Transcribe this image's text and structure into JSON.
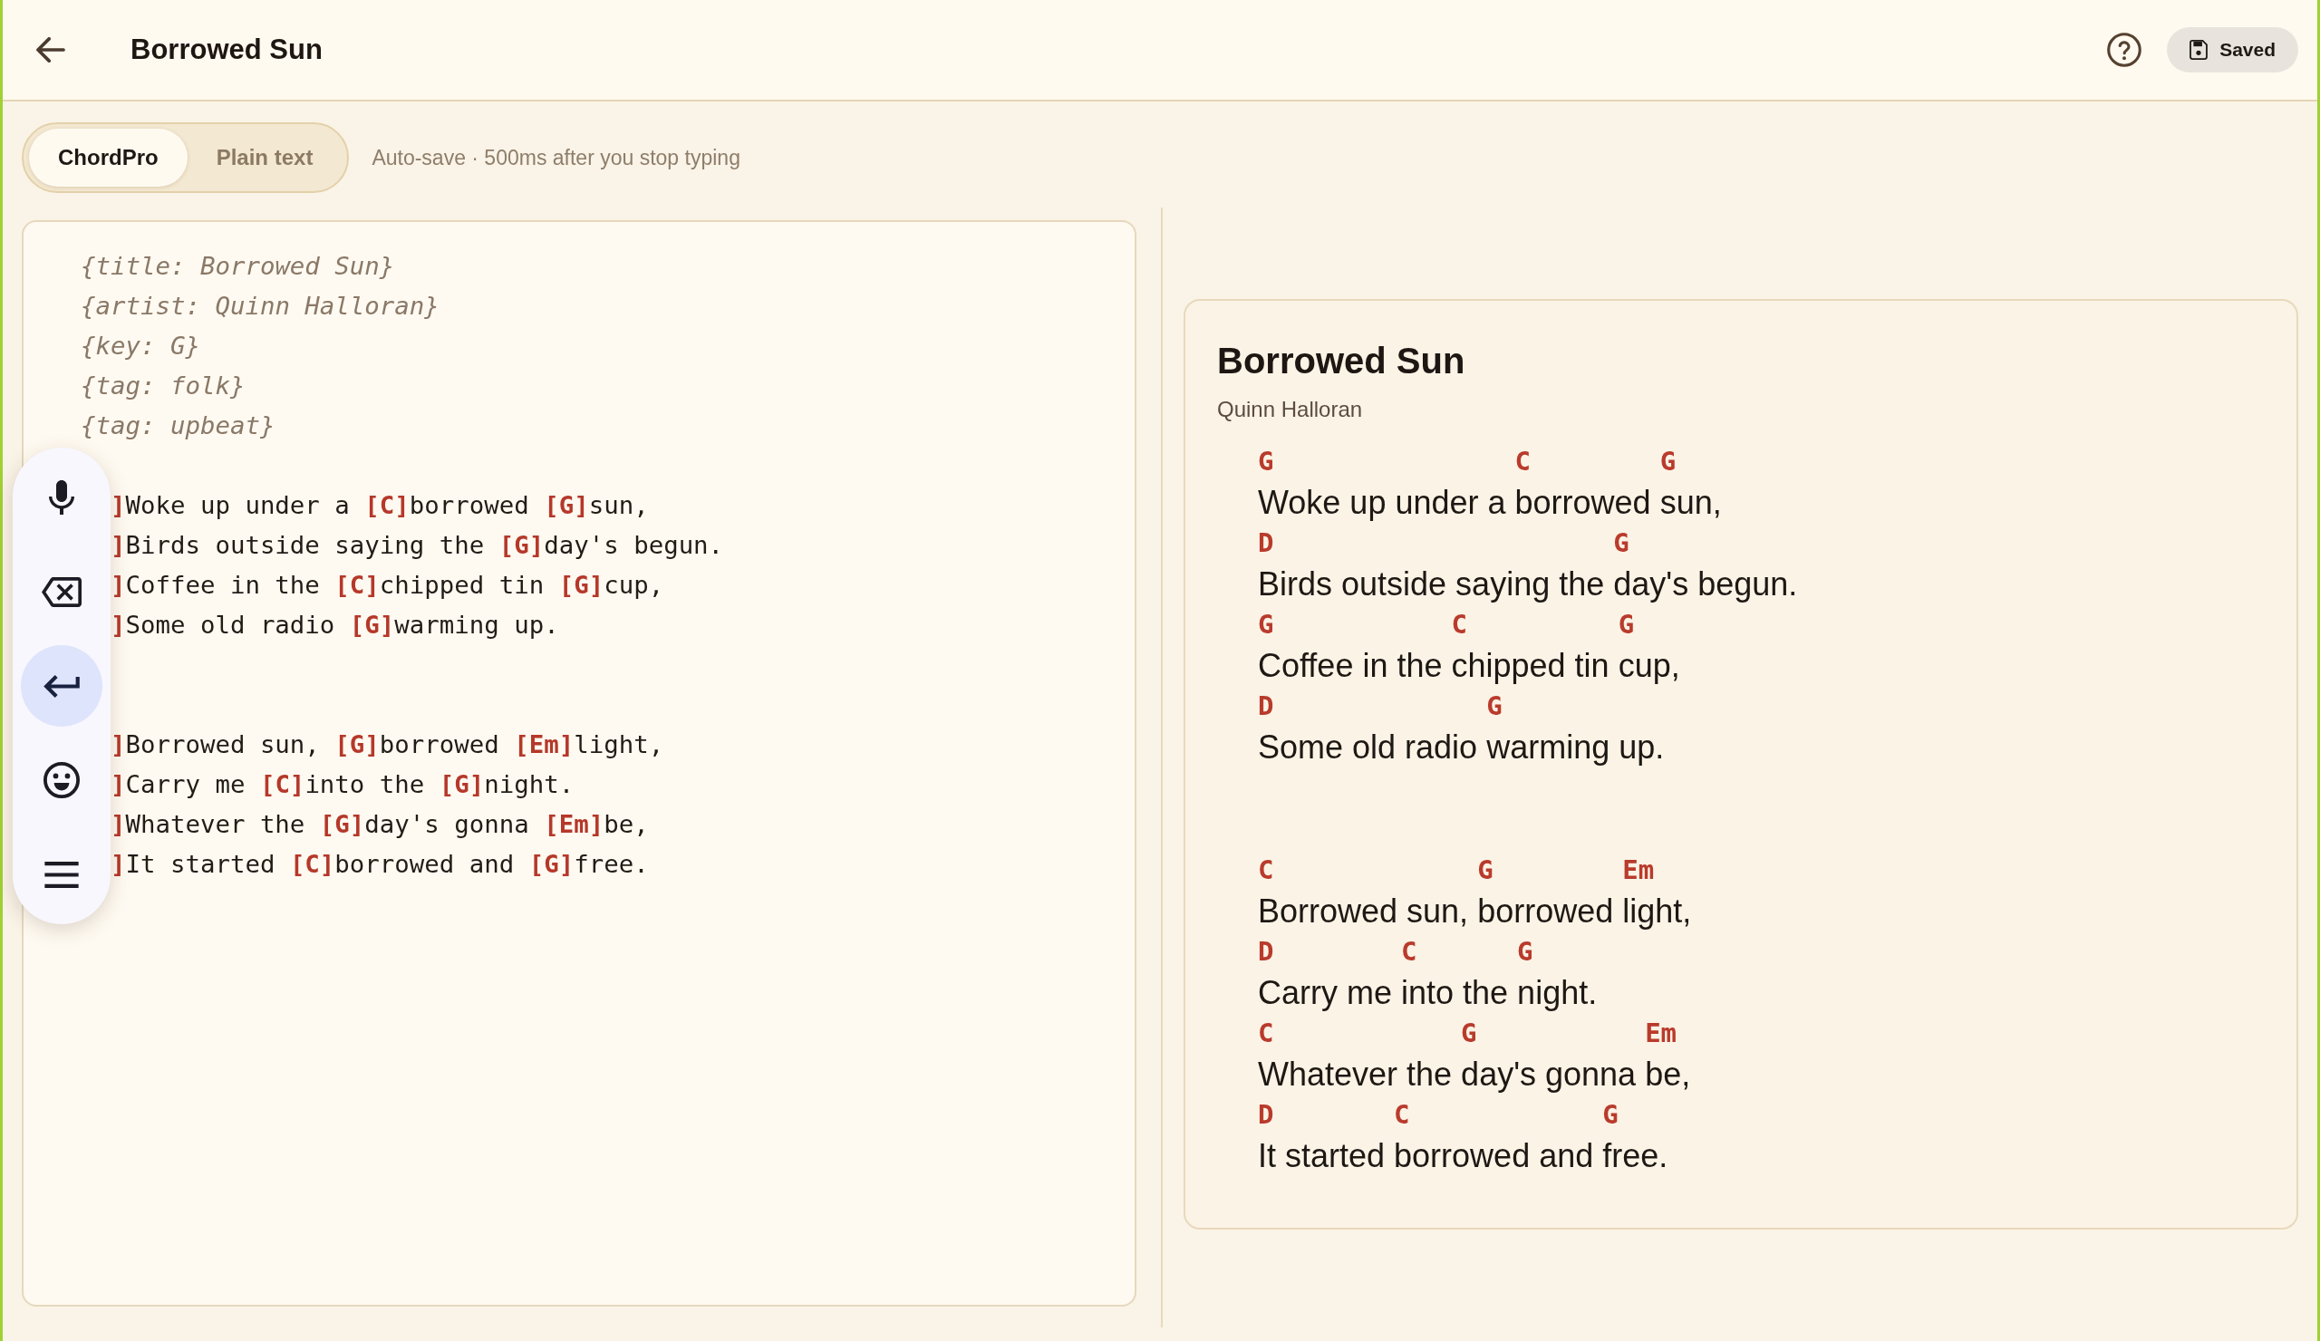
{
  "header": {
    "title": "Borrowed Sun",
    "save_button": {
      "label": "Saved"
    }
  },
  "tabs": [
    {
      "label": "ChordPro",
      "selected": true
    },
    {
      "label": "Plain text",
      "selected": false
    }
  ],
  "autosave_hint": "Auto-save · 500ms after you stop typing",
  "editor": {
    "lines": [
      {
        "kind": "directive",
        "text": "{title: Borrowed Sun}"
      },
      {
        "kind": "directive",
        "text": "{artist: Quinn Halloran}"
      },
      {
        "kind": "directive",
        "text": "{key: G}"
      },
      {
        "kind": "directive",
        "text": "{tag: folk}"
      },
      {
        "kind": "directive",
        "text": "{tag: upbeat}"
      },
      {
        "kind": "blank"
      },
      {
        "kind": "lyric",
        "segments": [
          {
            "kind": "chord",
            "text": "]"
          },
          {
            "kind": "text",
            "text": "Woke up under a "
          },
          {
            "kind": "chord",
            "text": "[C]"
          },
          {
            "kind": "text",
            "text": "borrowed "
          },
          {
            "kind": "chord",
            "text": "[G]"
          },
          {
            "kind": "text",
            "text": "sun,"
          }
        ]
      },
      {
        "kind": "lyric",
        "segments": [
          {
            "kind": "chord",
            "text": "]"
          },
          {
            "kind": "text",
            "text": "Birds outside saying the "
          },
          {
            "kind": "chord",
            "text": "[G]"
          },
          {
            "kind": "text",
            "text": "day's begun."
          }
        ]
      },
      {
        "kind": "lyric",
        "segments": [
          {
            "kind": "chord",
            "text": "]"
          },
          {
            "kind": "text",
            "text": "Coffee in the "
          },
          {
            "kind": "chord",
            "text": "[C]"
          },
          {
            "kind": "text",
            "text": "chipped tin "
          },
          {
            "kind": "chord",
            "text": "[G]"
          },
          {
            "kind": "text",
            "text": "cup,"
          }
        ]
      },
      {
        "kind": "lyric",
        "segments": [
          {
            "kind": "chord",
            "text": "]"
          },
          {
            "kind": "text",
            "text": "Some old radio "
          },
          {
            "kind": "chord",
            "text": "[G]"
          },
          {
            "kind": "text",
            "text": "warming up."
          }
        ]
      },
      {
        "kind": "blank"
      },
      {
        "kind": "blank"
      },
      {
        "kind": "lyric",
        "segments": [
          {
            "kind": "chord",
            "text": "]"
          },
          {
            "kind": "text",
            "text": "Borrowed sun, "
          },
          {
            "kind": "chord",
            "text": "[G]"
          },
          {
            "kind": "text",
            "text": "borrowed "
          },
          {
            "kind": "chord",
            "text": "[Em]"
          },
          {
            "kind": "text",
            "text": "light,"
          }
        ]
      },
      {
        "kind": "lyric",
        "segments": [
          {
            "kind": "chord",
            "text": "]"
          },
          {
            "kind": "text",
            "text": "Carry me "
          },
          {
            "kind": "chord",
            "text": "[C]"
          },
          {
            "kind": "text",
            "text": "into the "
          },
          {
            "kind": "chord",
            "text": "[G]"
          },
          {
            "kind": "text",
            "text": "night."
          }
        ]
      },
      {
        "kind": "lyric",
        "segments": [
          {
            "kind": "chord",
            "text": "]"
          },
          {
            "kind": "text",
            "text": "Whatever the "
          },
          {
            "kind": "chord",
            "text": "[G]"
          },
          {
            "kind": "text",
            "text": "day's gonna "
          },
          {
            "kind": "chord",
            "text": "[Em]"
          },
          {
            "kind": "text",
            "text": "be,"
          }
        ]
      },
      {
        "kind": "lyric",
        "segments": [
          {
            "kind": "chord",
            "text": "]"
          },
          {
            "kind": "text",
            "text": "It started "
          },
          {
            "kind": "chord",
            "text": "[C]"
          },
          {
            "kind": "text",
            "text": "borrowed and "
          },
          {
            "kind": "chord",
            "text": "[G]"
          },
          {
            "kind": "text",
            "text": "free."
          }
        ]
      }
    ]
  },
  "floating_toolbar": {
    "tools": [
      {
        "kind": "dictate",
        "selected": false
      },
      {
        "kind": "backspace",
        "selected": false
      },
      {
        "kind": "enter",
        "selected": true
      },
      {
        "kind": "emoji",
        "selected": false
      },
      {
        "kind": "menu",
        "selected": false
      }
    ]
  },
  "preview": {
    "title": "Borrowed Sun",
    "artist": "Quinn Halloran",
    "stanzas": [
      {
        "lines": [
          {
            "segments": [
              {
                "chord": "G",
                "text": "Woke up under a "
              },
              {
                "chord": "C",
                "text": "borrowed "
              },
              {
                "chord": "G",
                "text": "sun,"
              }
            ]
          },
          {
            "segments": [
              {
                "chord": "D",
                "text": "Birds outside saying the "
              },
              {
                "chord": "G",
                "text": "day's begun."
              }
            ]
          },
          {
            "segments": [
              {
                "chord": "G",
                "text": "Coffee in the "
              },
              {
                "chord": "C",
                "text": "chipped tin "
              },
              {
                "chord": "G",
                "text": "cup,"
              }
            ]
          },
          {
            "segments": [
              {
                "chord": "D",
                "text": "Some old radio "
              },
              {
                "chord": "G",
                "text": "warming up."
              }
            ]
          }
        ]
      },
      {
        "lines": [
          {
            "segments": [
              {
                "chord": "C",
                "text": "Borrowed sun, "
              },
              {
                "chord": "G",
                "text": "borrowed "
              },
              {
                "chord": "Em",
                "text": "light,"
              }
            ]
          },
          {
            "segments": [
              {
                "chord": "D",
                "text": "Carry me "
              },
              {
                "chord": "C",
                "text": "into the "
              },
              {
                "chord": "G",
                "text": "night."
              }
            ]
          },
          {
            "segments": [
              {
                "chord": "C",
                "text": "Whatever the "
              },
              {
                "chord": "G",
                "text": "day's gonna "
              },
              {
                "chord": "Em",
                "text": "be,"
              }
            ]
          },
          {
            "segments": [
              {
                "chord": "D",
                "text": "It started "
              },
              {
                "chord": "C",
                "text": "borrowed and "
              },
              {
                "chord": "G",
                "text": "free."
              }
            ]
          }
        ]
      }
    ]
  }
}
